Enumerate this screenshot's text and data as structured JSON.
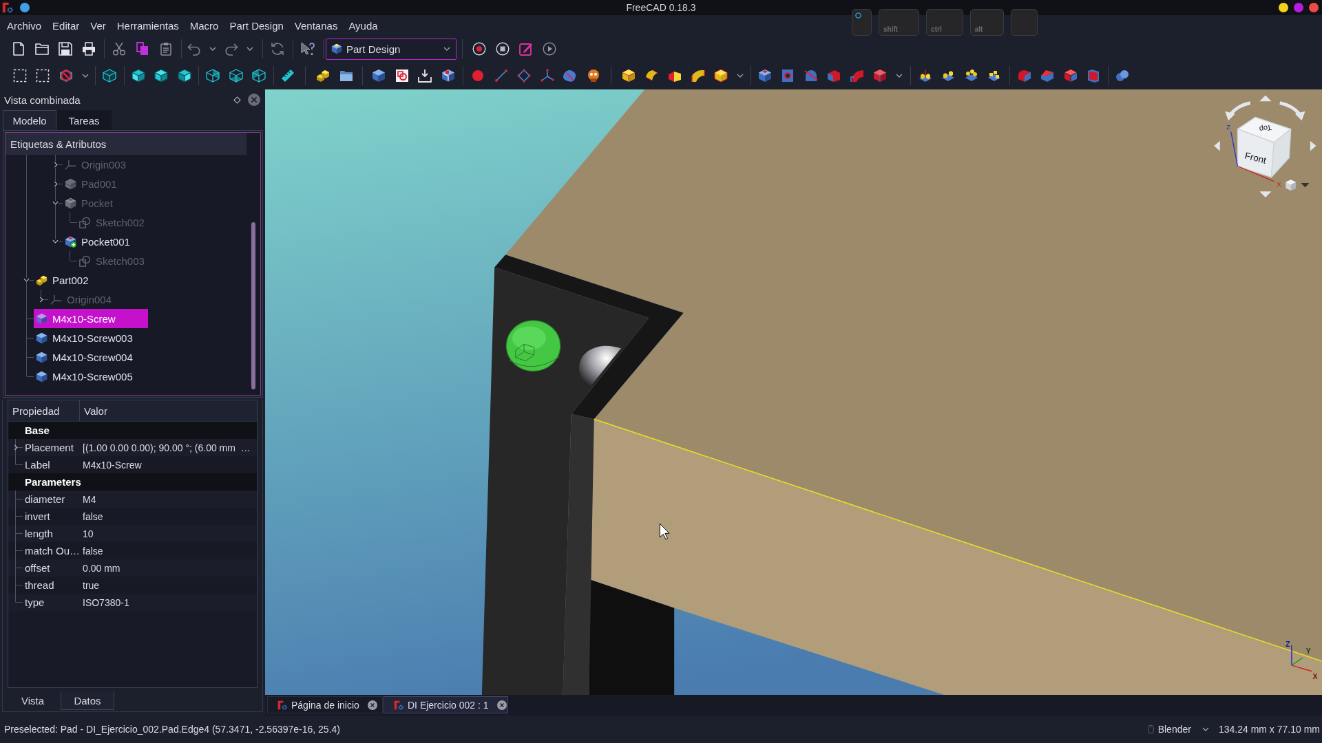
{
  "window": {
    "title": "FreeCAD 0.18.3"
  },
  "key_overlay": [
    {
      "kind": "mouse"
    },
    {
      "kind": "key",
      "label": "shift"
    },
    {
      "kind": "key",
      "label": "ctrl"
    },
    {
      "kind": "key",
      "label": "alt"
    },
    {
      "kind": "key"
    }
  ],
  "menu": [
    "Archivo",
    "Editar",
    "Ver",
    "Herramientas",
    "Macro",
    "Part Design",
    "Ventanas",
    "Ayuda"
  ],
  "toolbar": {
    "workbench": "Part Design"
  },
  "combo_view": {
    "title": "Vista combinada",
    "tabs": [
      {
        "label": "Modelo",
        "selected": true
      },
      {
        "label": "Tareas",
        "selected": false
      }
    ],
    "tree": {
      "header": "Etiquetas & Atributos",
      "items": [
        {
          "children": [
            {
              "children": [
                {
                  "label": "Origin003",
                  "kind": "origin",
                  "visible": false,
                  "selected": false,
                  "tip": false,
                  "expanded": false
                },
                {
                  "label": "Pad001",
                  "kind": "pad",
                  "visible": false,
                  "selected": false,
                  "tip": false,
                  "expanded": false
                },
                {
                  "label": "Pocket",
                  "kind": "pocket",
                  "visible": false,
                  "selected": false,
                  "tip": false,
                  "expanded": true,
                  "children": [
                    {
                      "label": "Sketch002",
                      "kind": "sketch",
                      "visible": false,
                      "selected": false,
                      "tip": false
                    }
                  ]
                },
                {
                  "label": "Pocket001",
                  "kind": "pocket",
                  "visible": true,
                  "selected": false,
                  "tip": true,
                  "expanded": true,
                  "children": [
                    {
                      "label": "Sketch003",
                      "kind": "sketch",
                      "visible": false,
                      "selected": false,
                      "tip": false
                    }
                  ]
                }
              ]
            }
          ]
        },
        {
          "label": "Part002",
          "kind": "part",
          "visible": true,
          "selected": false,
          "tip": false,
          "expanded": true,
          "children": [
            {
              "label": "Origin004",
              "kind": "origin",
              "visible": false,
              "selected": false,
              "tip": false,
              "expanded": false
            }
          ]
        },
        {
          "label": "M4x10-Screw",
          "kind": "screw",
          "visible": true,
          "selected": true,
          "tip": false
        },
        {
          "label": "M4x10-Screw003",
          "kind": "screw",
          "visible": true,
          "selected": false,
          "tip": false
        },
        {
          "label": "M4x10-Screw004",
          "kind": "screw",
          "visible": true,
          "selected": false,
          "tip": false
        },
        {
          "label": "M4x10-Screw005",
          "kind": "screw",
          "visible": true,
          "selected": false,
          "tip": false
        }
      ]
    },
    "properties": {
      "columns": [
        "Propiedad",
        "Valor"
      ],
      "groups": [
        {
          "label": "Base",
          "rows": [
            {
              "name": "Placement",
              "value": "[(1.00 0.00 0.00); 90.00 °; (6.00 mm  …",
              "expanded": false
            },
            {
              "name": "Label",
              "value": "M4x10-Screw"
            }
          ]
        },
        {
          "label": "Parameters",
          "rows": [
            {
              "name": "diameter",
              "value": "M4"
            },
            {
              "name": "invert",
              "value": "false"
            },
            {
              "name": "length",
              "value": "10"
            },
            {
              "name": "match Ou…",
              "value": "false"
            },
            {
              "name": "offset",
              "value": "0.00 mm"
            },
            {
              "name": "thread",
              "value": "true"
            },
            {
              "name": "type",
              "value": "ISO7380-1"
            }
          ]
        }
      ],
      "tabs": [
        {
          "label": "Vista",
          "selected": false
        },
        {
          "label": "Datos",
          "selected": true
        }
      ]
    }
  },
  "viewport": {
    "nav_cube": {
      "faces": [
        "Top",
        "Front"
      ],
      "axes": [
        "Z",
        "X"
      ]
    },
    "triad": [
      "Z",
      "Y",
      "X"
    ]
  },
  "document_tabs": [
    {
      "label": "Página de inicio",
      "selected": false
    },
    {
      "label": "DI Ejercicio 002 : 1",
      "selected": true
    }
  ],
  "status_bar": {
    "message": "Preselected: Pad - DI_Ejercicio_002.Pad.Edge4 (57.3471, -2.56397e-16, 25.4)",
    "navigation": "Blender",
    "dimensions": "134.24 mm x 77.10 mm"
  }
}
